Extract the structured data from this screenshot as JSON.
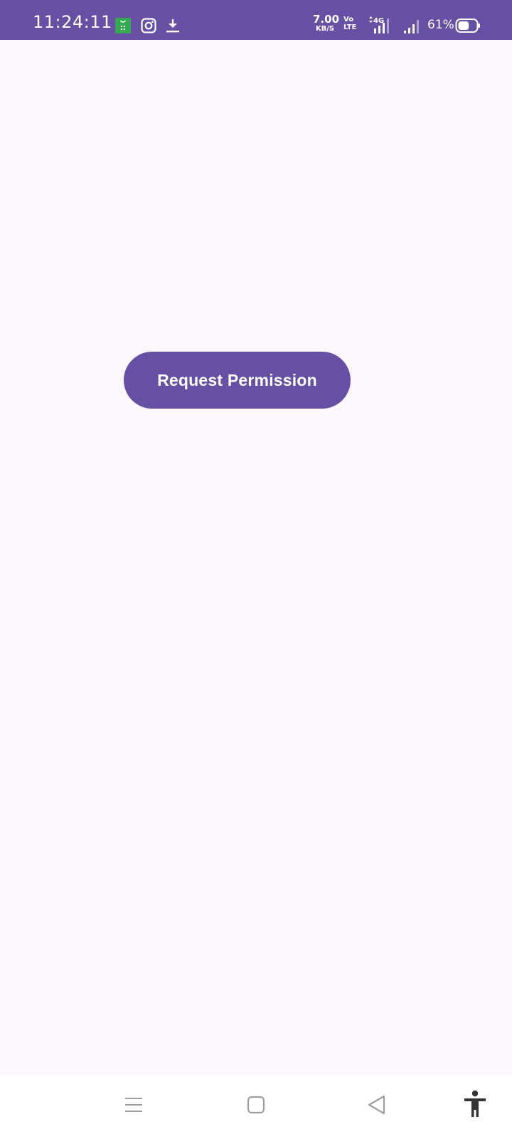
{
  "status_bar": {
    "time": "11:24:11",
    "network_speed_value": "7.00",
    "network_speed_unit": "KB/S",
    "volte_line1": "Vo",
    "volte_line2": "LTE",
    "sim_network": "4G",
    "battery_percent": "61%",
    "battery_level": 0.61,
    "icons": [
      "shop-app-icon",
      "instagram-icon",
      "download-icon",
      "volte-icon",
      "signal-sim1-icon",
      "signal-sim2-icon",
      "battery-icon"
    ]
  },
  "main": {
    "request_button_label": "Request Permission"
  },
  "nav_bar": {
    "icons": [
      "menu-icon",
      "home-icon",
      "back-icon",
      "accessibility-icon"
    ]
  },
  "colors": {
    "primary": "#6750a4",
    "background": "#fdf7fe",
    "on_primary": "#ffffff",
    "nav_icon": "#9e9e9e",
    "accessibility_icon": "#333333"
  }
}
